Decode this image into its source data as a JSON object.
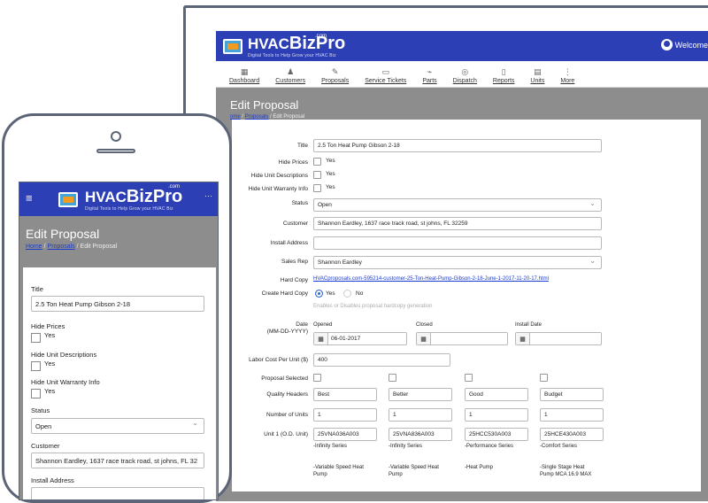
{
  "brand": {
    "name_part1": "HVAC",
    "name_part2": "BizPro",
    "com": ".com",
    "tagline": "Digital Tools to Help Grow your HVAC Biz"
  },
  "header": {
    "welcome": "Welcome De"
  },
  "nav": {
    "items": [
      {
        "label": "Dashboard",
        "icon": "▦"
      },
      {
        "label": "Customers",
        "icon": "♟"
      },
      {
        "label": "Proposals",
        "icon": "✎"
      },
      {
        "label": "Service Tickets",
        "icon": "▭"
      },
      {
        "label": "Parts",
        "icon": "⌁"
      },
      {
        "label": "Dispatch",
        "icon": "◎"
      },
      {
        "label": "Reports",
        "icon": "▯"
      },
      {
        "label": "Units",
        "icon": "▤"
      },
      {
        "label": "More",
        "icon": "⋮"
      }
    ]
  },
  "page": {
    "title": "Edit Proposal",
    "crumb_home": "Home",
    "crumb_home_clipped": "ome",
    "crumb_proposals": "Proposals",
    "crumb_current": "Edit Proposal",
    "sep": "/"
  },
  "form": {
    "title_label": "Title",
    "title_value": "2.5 Ton Heat Pump Gibson 2-18",
    "hide_prices_label": "Hide Prices",
    "hide_unit_desc_label": "Hide Unit Descriptions",
    "hide_unit_warranty_label": "Hide Unit Warranty Info",
    "yes": "Yes",
    "no": "No",
    "status_label": "Status",
    "status_value": "Open",
    "customer_label": "Customer",
    "customer_value": "Shannon Eardley, 1637 race track road, st johns, FL 32259",
    "install_address_label": "Install Address",
    "sales_rep_label": "Sales Rep",
    "sales_rep_value": "Shannon Eardley",
    "hard_copy_label": "Hard Copy",
    "hard_copy_link": "HVACproposals.com-595214-customer-25-Ton-Heat-Pump-Gibson-2-18-June-1-2017-11-20-17.html",
    "create_hard_copy_label": "Create Hard Copy",
    "create_hard_copy_help": "Enables or Disables proposal hardcopy generation",
    "date_label": "Date",
    "date_format": "(MM-DD-YYYY)",
    "opened_label": "Opened",
    "opened_value": "06-01-2017",
    "closed_label": "Closed",
    "install_date_label": "Install Date",
    "labor_cost_label": "Labor Cost Per Unit ($)",
    "labor_cost_value": "400",
    "proposal_selected_label": "Proposal Selected",
    "quality_headers_label": "Quality Headers",
    "number_of_units_label": "Number of Units",
    "unit1_label": "Unit 1 (O.D. Unit)",
    "options": [
      {
        "quality": "Best",
        "units": "1",
        "unit_code": "25VNA036A003",
        "series": "-Infinity Series",
        "desc1": "-Variable Speed Heat",
        "desc2": "Pump"
      },
      {
        "quality": "Better",
        "units": "1",
        "unit_code": "25VNA836A003",
        "series": "-Infinity Series",
        "desc1": "-Variable Speed Heat",
        "desc2": "Pump"
      },
      {
        "quality": "Good",
        "units": "1",
        "unit_code": "25HCC530A003",
        "series": "-Performance Series",
        "desc1": "-Heat Pump",
        "desc2": ""
      },
      {
        "quality": "Budget",
        "units": "1",
        "unit_code": "25HCE430A003",
        "series": "-Comfort Series",
        "desc1": "-Single Stage Heat",
        "desc2": "Pump MCA 16.9 MAX"
      }
    ]
  },
  "mobile": {
    "customer_value": "Shannon Eardley, 1637 race track road, st johns, FL 32"
  },
  "colors": {
    "brand_blue": "#2d3fb4",
    "page_gray": "#8d8d8d",
    "link_blue": "#1b3bd0"
  }
}
